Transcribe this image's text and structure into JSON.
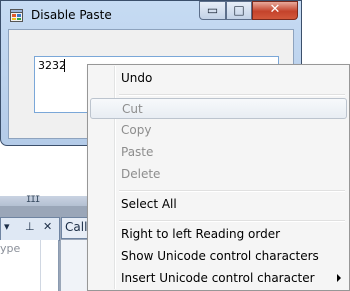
{
  "window": {
    "title": "Disable Paste",
    "textbox_value": "3232",
    "minimize_glyph": "▭",
    "maximize_glyph": "□",
    "close_glyph": "✕"
  },
  "background": {
    "splitter_grip": "III",
    "left_tab_glyphs": [
      "▾",
      "⊥",
      "✕"
    ],
    "right_tab_label": "Call",
    "panel_text": "ype"
  },
  "context_menu": {
    "items": [
      {
        "label": "Undo",
        "enabled": true
      },
      {
        "label": "Cut",
        "enabled": false,
        "highlighted": true
      },
      {
        "label": "Copy",
        "enabled": false
      },
      {
        "label": "Paste",
        "enabled": false
      },
      {
        "label": "Delete",
        "enabled": false
      },
      {
        "label": "Select All",
        "enabled": true
      },
      {
        "label": "Right to left Reading order",
        "enabled": true
      },
      {
        "label": "Show Unicode control characters",
        "enabled": true
      },
      {
        "label": "Insert Unicode control character",
        "enabled": true,
        "submenu": true
      }
    ]
  },
  "colors": {
    "title_gradient_top": "#c6dbf3",
    "close_button": "#c4432b",
    "disabled_text": "#8d8d8d",
    "menu_background": "#f5f5f5"
  }
}
